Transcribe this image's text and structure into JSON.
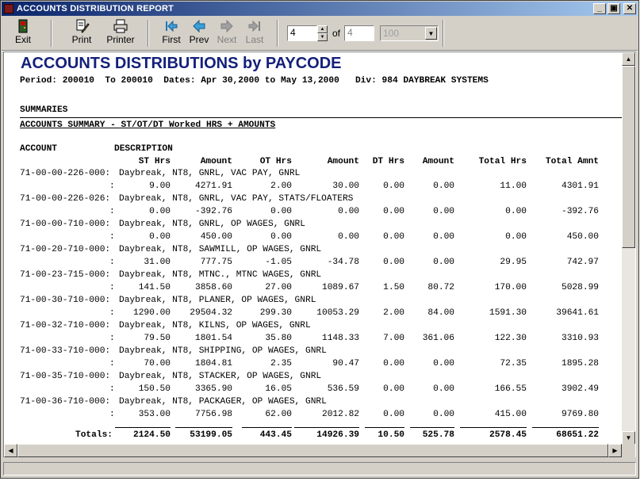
{
  "window": {
    "title": "ACCOUNTS DISTRIBUTION REPORT"
  },
  "toolbar": {
    "exit_label": "Exit",
    "print_label": "Print",
    "printer_label": "Printer",
    "first_label": "First",
    "prev_label": "Prev",
    "next_label": "Next",
    "last_label": "Last",
    "current_page": "4",
    "of_label": "of",
    "total_pages": "4",
    "zoom_value": "100"
  },
  "report": {
    "title": "ACCOUNTS DISTRIBUTIONS by PAYCODE",
    "period_line": "Period: 200010  To 200010  Dates: Apr 30,2000 to May 13,2000   Div: 984 DAYBREAK SYSTEMS",
    "summaries_label": "SUMMARIES",
    "section_title": "ACCOUNTS SUMMARY - ST/OT/DT Worked HRS + AMOUNTS",
    "header_account": "ACCOUNT",
    "header_description": "DESCRIPTION",
    "columns": [
      "ST Hrs",
      "Amount",
      "OT Hrs",
      "Amount",
      "DT Hrs",
      "Amount",
      "Total Hrs",
      "Total Amnt"
    ],
    "rows": [
      {
        "account": "71-00-00-226-000:",
        "description": "Daybreak, NT8, GNRL, VAC PAY, GNRL",
        "values": [
          "9.00",
          "4271.91",
          "2.00",
          "30.00",
          "0.00",
          "0.00",
          "11.00",
          "4301.91"
        ]
      },
      {
        "account": "71-00-00-226-026:",
        "description": "Daybreak, NT8, GNRL, VAC PAY, STATS/FLOATERS",
        "values": [
          "0.00",
          "-392.76",
          "0.00",
          "0.00",
          "0.00",
          "0.00",
          "0.00",
          "-392.76"
        ]
      },
      {
        "account": "71-00-00-710-000:",
        "description": "Daybreak, NT8, GNRL, OP WAGES, GNRL",
        "values": [
          "0.00",
          "450.00",
          "0.00",
          "0.00",
          "0.00",
          "0.00",
          "0.00",
          "450.00"
        ]
      },
      {
        "account": "71-00-20-710-000:",
        "description": "Daybreak, NT8, SAWMILL, OP WAGES, GNRL",
        "values": [
          "31.00",
          "777.75",
          "-1.05",
          "-34.78",
          "0.00",
          "0.00",
          "29.95",
          "742.97"
        ]
      },
      {
        "account": "71-00-23-715-000:",
        "description": "Daybreak, NT8, MTNC., MTNC WAGES, GNRL",
        "values": [
          "141.50",
          "3858.60",
          "27.00",
          "1089.67",
          "1.50",
          "80.72",
          "170.00",
          "5028.99"
        ]
      },
      {
        "account": "71-00-30-710-000:",
        "description": "Daybreak, NT8, PLANER, OP WAGES, GNRL",
        "values": [
          "1290.00",
          "29504.32",
          "299.30",
          "10053.29",
          "2.00",
          "84.00",
          "1591.30",
          "39641.61"
        ]
      },
      {
        "account": "71-00-32-710-000:",
        "description": "Daybreak, NT8, KILNS, OP WAGES, GNRL",
        "values": [
          "79.50",
          "1801.54",
          "35.80",
          "1148.33",
          "7.00",
          "361.06",
          "122.30",
          "3310.93"
        ]
      },
      {
        "account": "71-00-33-710-000:",
        "description": "Daybreak, NT8, SHIPPING, OP WAGES, GNRL",
        "values": [
          "70.00",
          "1804.81",
          "2.35",
          "90.47",
          "0.00",
          "0.00",
          "72.35",
          "1895.28"
        ]
      },
      {
        "account": "71-00-35-710-000:",
        "description": "Daybreak, NT8, STACKER, OP WAGES, GNRL",
        "values": [
          "150.50",
          "3365.90",
          "16.05",
          "536.59",
          "0.00",
          "0.00",
          "166.55",
          "3902.49"
        ]
      },
      {
        "account": "71-00-36-710-000:",
        "description": "Daybreak, NT8, PACKAGER, OP WAGES, GNRL",
        "values": [
          "353.00",
          "7756.98",
          "62.00",
          "2012.82",
          "0.00",
          "0.00",
          "415.00",
          "9769.80"
        ]
      }
    ],
    "row_colon": ":",
    "totals_label": "Totals:",
    "totals": [
      "2124.50",
      "53199.05",
      "443.45",
      "14926.39",
      "10.50",
      "525.78",
      "2578.45",
      "68651.22"
    ]
  }
}
